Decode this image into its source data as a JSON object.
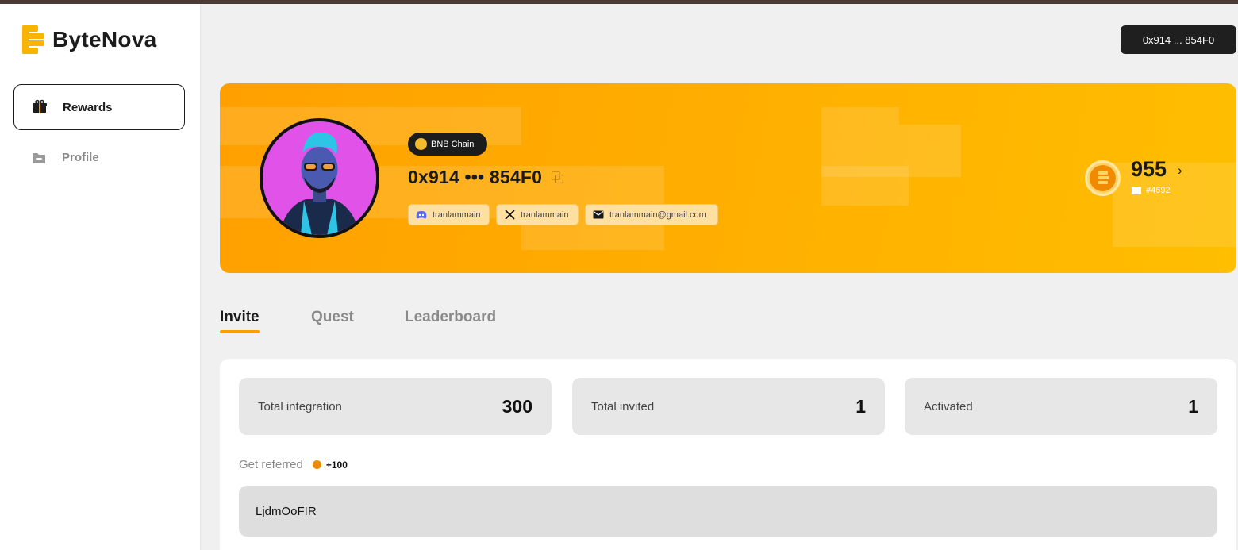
{
  "brand": {
    "name": "ByteNova",
    "accent": "#f7b500"
  },
  "sidebar": {
    "items": [
      {
        "label": "Rewards",
        "icon": "gift-icon",
        "active": true
      },
      {
        "label": "Profile",
        "icon": "folder-icon",
        "active": false
      }
    ]
  },
  "header": {
    "wallet_label": "0x914 ... 854F0"
  },
  "profile": {
    "chain": "BNB Chain",
    "address": "0x914 ••• 854F0",
    "socials": {
      "discord": "tranlammain",
      "x": "tranlammain",
      "email": "tranlammain@gmail.com"
    },
    "points": "955",
    "rank": "#4692"
  },
  "tabs": [
    {
      "label": "Invite",
      "active": true
    },
    {
      "label": "Quest",
      "active": false
    },
    {
      "label": "Leaderboard",
      "active": false
    }
  ],
  "stats": [
    {
      "label": "Total integration",
      "value": "300"
    },
    {
      "label": "Total invited",
      "value": "1"
    },
    {
      "label": "Activated",
      "value": "1"
    }
  ],
  "referral": {
    "label": "Get referred",
    "bonus": "+100",
    "code": "LjdmOoFIR"
  }
}
